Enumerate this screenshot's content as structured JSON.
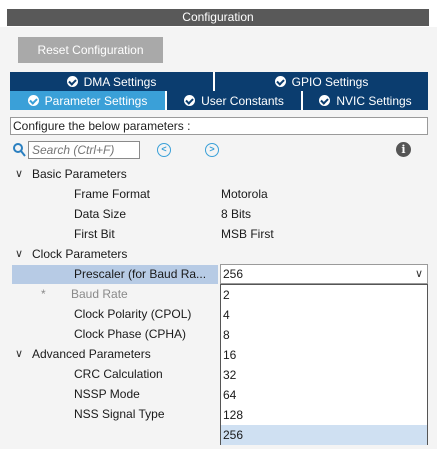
{
  "window": {
    "title": "Configuration"
  },
  "toolbar": {
    "reset_label": "Reset Configuration"
  },
  "tabs": {
    "row1": [
      {
        "label": "DMA Settings",
        "active": false
      },
      {
        "label": "GPIO Settings",
        "active": false
      }
    ],
    "row2": [
      {
        "label": "Parameter Settings",
        "active": true
      },
      {
        "label": "User Constants",
        "active": false
      },
      {
        "label": "NVIC Settings",
        "active": false
      }
    ]
  },
  "configure_text": "Configure the below parameters :",
  "search": {
    "placeholder": "Search (Ctrl+F)"
  },
  "tree": {
    "basic": {
      "label": "Basic Parameters",
      "params": [
        {
          "name": "Frame Format",
          "value": "Motorola"
        },
        {
          "name": "Data Size",
          "value": "8 Bits"
        },
        {
          "name": "First Bit",
          "value": "MSB First"
        }
      ]
    },
    "clock": {
      "label": "Clock Parameters",
      "prescaler": {
        "name": "Prescaler (for Baud Ra...",
        "value": "256"
      },
      "baud_rate": {
        "name": "Baud Rate",
        "marker": "*"
      },
      "params": [
        {
          "name": "Clock Polarity (CPOL)"
        },
        {
          "name": "Clock Phase (CPHA)"
        }
      ]
    },
    "advanced": {
      "label": "Advanced Parameters",
      "params": [
        {
          "name": "CRC Calculation"
        },
        {
          "name": "NSSP Mode"
        },
        {
          "name": "NSS Signal Type"
        }
      ]
    }
  },
  "dropdown": {
    "options": [
      "2",
      "4",
      "8",
      "16",
      "32",
      "64",
      "128",
      "256"
    ],
    "selected": "256"
  },
  "colors": {
    "tab_dark": "#0b3d6f",
    "tab_active": "#3aa0d8",
    "title_bg": "#595959",
    "selection": "#b7cbe5"
  }
}
